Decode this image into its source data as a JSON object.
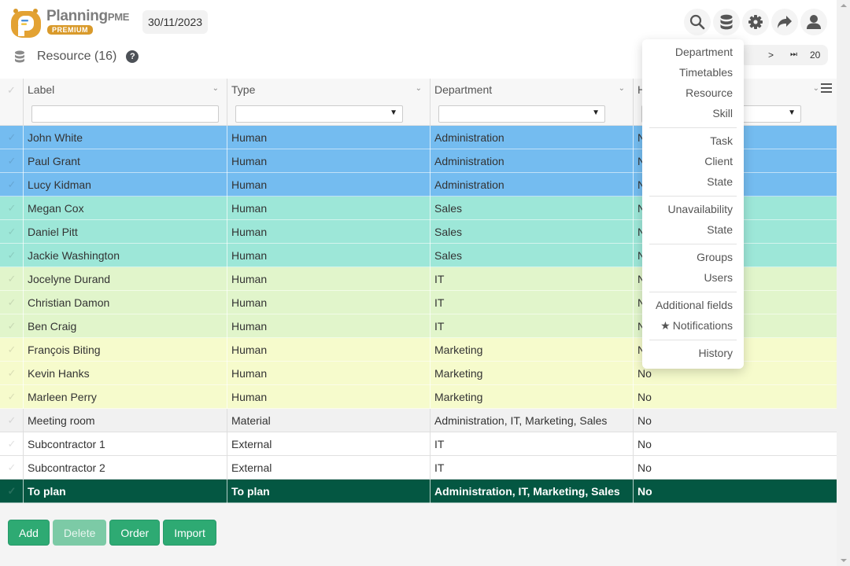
{
  "app": {
    "logo_text": "Planning",
    "logo_suffix": "PME",
    "badge": "PREMIUM",
    "date": "30/11/2023"
  },
  "page": {
    "title": "Resource (16)",
    "help": "?"
  },
  "toolbar_icons": [
    "search-icon",
    "database-icon",
    "gear-icon",
    "share-icon",
    "user-icon"
  ],
  "pager": {
    "next": ">",
    "last": "⏭",
    "page_size": "20"
  },
  "columns": [
    {
      "label": "Label",
      "filter_type": "text",
      "filter_value": ""
    },
    {
      "label": "Type",
      "filter_type": "select",
      "filter_value": ""
    },
    {
      "label": "Department",
      "filter_type": "select",
      "filter_value": ""
    },
    {
      "label": "H",
      "filter_type": "select",
      "filter_value": ""
    }
  ],
  "rows": [
    {
      "label": "John White",
      "type": "Human",
      "department": "Administration",
      "h": "No",
      "color": "#74bcf0"
    },
    {
      "label": "Paul Grant",
      "type": "Human",
      "department": "Administration",
      "h": "No",
      "color": "#74bcf0"
    },
    {
      "label": "Lucy Kidman",
      "type": "Human",
      "department": "Administration",
      "h": "No",
      "color": "#74bcf0"
    },
    {
      "label": "Megan Cox",
      "type": "Human",
      "department": "Sales",
      "h": "No",
      "color": "#9de7d8"
    },
    {
      "label": "Daniel Pitt",
      "type": "Human",
      "department": "Sales",
      "h": "No",
      "color": "#9de7d8"
    },
    {
      "label": "Jackie Washington",
      "type": "Human",
      "department": "Sales",
      "h": "No",
      "color": "#9de7d8"
    },
    {
      "label": "Jocelyne Durand",
      "type": "Human",
      "department": "IT",
      "h": "No",
      "color": "#e1f5cb"
    },
    {
      "label": "Christian Damon",
      "type": "Human",
      "department": "IT",
      "h": "No",
      "color": "#e1f5cb"
    },
    {
      "label": "Ben Craig",
      "type": "Human",
      "department": "IT",
      "h": "No",
      "color": "#e1f5cb"
    },
    {
      "label": "François Biting",
      "type": "Human",
      "department": "Marketing",
      "h": "No",
      "color": "#f6fbcc"
    },
    {
      "label": "Kevin Hanks",
      "type": "Human",
      "department": "Marketing",
      "h": "No",
      "color": "#f6fbcc"
    },
    {
      "label": "Marleen Perry",
      "type": "Human",
      "department": "Marketing",
      "h": "No",
      "color": "#f6fbcc"
    },
    {
      "label": "Meeting room",
      "type": "Material",
      "department": "Administration, IT, Marketing, Sales",
      "h": "No",
      "color": "#f1f1f1"
    },
    {
      "label": "Subcontractor 1",
      "type": "External",
      "department": "IT",
      "h": "No",
      "color": "#ffffff"
    },
    {
      "label": "Subcontractor 2",
      "type": "External",
      "department": "IT",
      "h": "No",
      "color": "#ffffff"
    },
    {
      "label": "To plan",
      "type": "To plan",
      "department": "Administration, IT, Marketing, Sales",
      "h": "No",
      "color": "#045742"
    }
  ],
  "buttons": {
    "add": "Add",
    "delete": "Delete",
    "order": "Order",
    "import": "Import"
  },
  "dropdown_menu": {
    "groups": [
      [
        "Department",
        "Timetables",
        "Resource",
        "Skill"
      ],
      [
        "Task",
        "Client",
        "State"
      ],
      [
        "Unavailability",
        "State"
      ],
      [
        "Groups",
        "Users"
      ],
      [
        "Additional fields",
        "Notifications"
      ],
      [
        "History"
      ]
    ],
    "starred": "Notifications"
  },
  "colors": {
    "accent_green": "#2eaa73",
    "total_row": "#045742",
    "logo_orange": "#d99a2b"
  }
}
